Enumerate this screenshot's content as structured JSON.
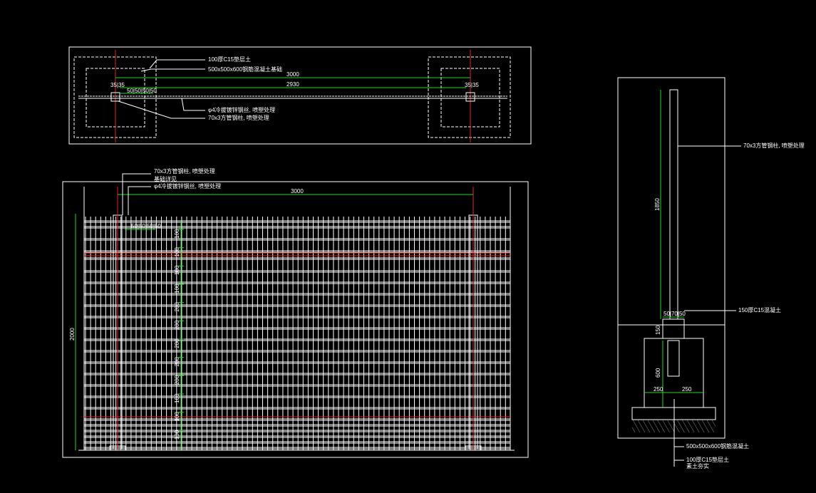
{
  "colors": {
    "background": "#000000",
    "line": "#ffffff",
    "dimension": "#1fd81f",
    "centerline": "#e02020"
  },
  "plan_view": {
    "labels": {
      "found_base": "100厚C15垫层土",
      "found_block": "500x500x600钢筋混凝土基础",
      "mesh": "φ4冷拔镀锌钢丝, 喷塑处理",
      "post": "70x3方管钢柱, 喷塑处理"
    },
    "dims": {
      "span": "3000",
      "inner": "2930",
      "edge_left": "35|35",
      "edge_right": "35|35",
      "mesh_grid": "50|50|50|50"
    }
  },
  "elevation_view": {
    "labels": {
      "post": "70x3方管钢柱, 喷塑处理",
      "post_note": "基础详见",
      "mesh": "φ4冷拔镀锌钢丝, 喷塑处理"
    },
    "dims": {
      "span": "3000",
      "height": "2000",
      "mesh_grid": "50|50|50|50",
      "rows": [
        "100",
        "100",
        "100",
        "100",
        "200",
        "200",
        "200",
        "200",
        "200",
        "100",
        "100",
        "100"
      ]
    }
  },
  "section_view": {
    "labels": {
      "post": "70x3方管钢柱, 喷塑处理",
      "base": "150厚C15混凝土",
      "found_block": "500x500x600钢筋混凝土",
      "found_base": "100厚C15垫层土",
      "soil": "素土夯实"
    },
    "dims": {
      "height": "1850",
      "post_split": "50|70|50",
      "found_h": "600",
      "found_left": "250",
      "found_right": "250",
      "base_h": "150"
    }
  }
}
